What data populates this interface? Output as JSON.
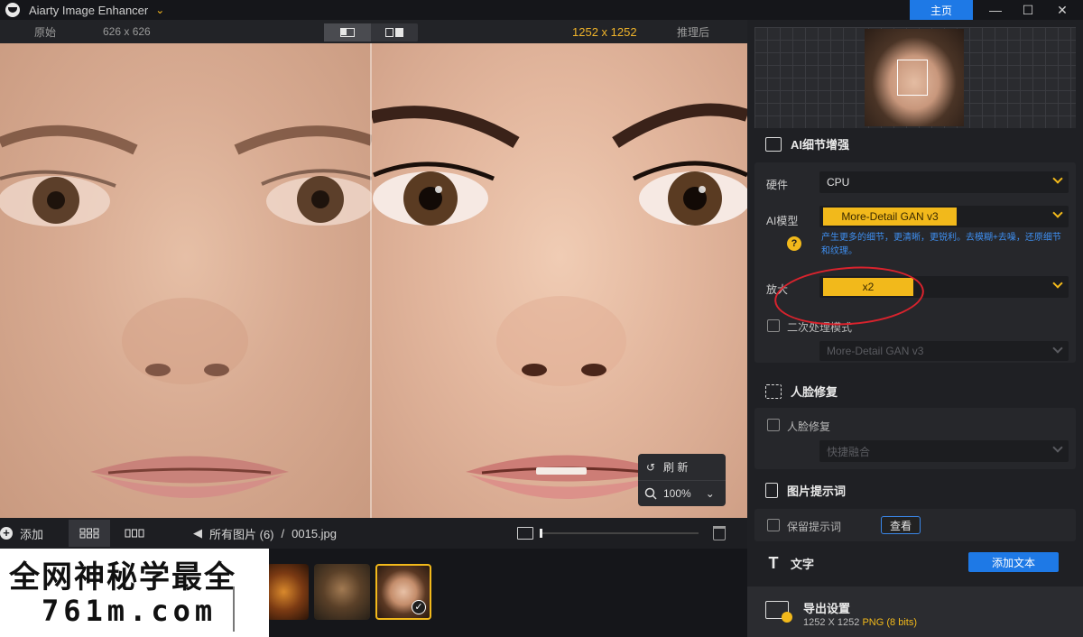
{
  "app": {
    "title": "Aiarty Image Enhancer",
    "home_label": "主页",
    "window_controls": [
      "—",
      "☐",
      "✕"
    ]
  },
  "compare": {
    "original_label": "原始",
    "original_resolution": "626 x 626",
    "enhanced_resolution": "1252 x 1252",
    "enhanced_label": "推理后"
  },
  "overlay": {
    "refresh_label": "刷 新",
    "zoom_value": "100%"
  },
  "bottom": {
    "add_label": "添加",
    "breadcrumb_all": "所有图片 (6)",
    "breadcrumb_sep": "/",
    "breadcrumb_file": "0015.jpg"
  },
  "watermark": {
    "line1": "全网神秘学最全",
    "line2": "761m.com"
  },
  "panel": {
    "detail_title": "AI细节增强",
    "hardware_label": "硬件",
    "hardware_value": "CPU",
    "model_label": "AI模型",
    "model_value": "More-Detail GAN  v3",
    "model_desc": "产生更多的细节，更清晰，更锐利。去模糊+去噪，还原细节和纹理。",
    "scale_label": "放大",
    "scale_value": "x2",
    "secondary_label": "二次处理模式",
    "secondary_value": "More-Detail GAN  v3",
    "face_title": "人脸修复",
    "face_checkbox": "人脸修复",
    "face_select": "快捷融合",
    "prompt_title": "图片提示词",
    "prompt_checkbox": "保留提示词",
    "prompt_view": "查看",
    "text_title": "文字",
    "add_text": "添加文本",
    "export_title": "导出设置",
    "export_res": "1252 X 1252",
    "export_format": "PNG",
    "export_bits": "(8 bits)"
  },
  "colors": {
    "accent": "#f2b91b",
    "primary_blue": "#1e79e6",
    "highlight_ring": "#d9232d"
  }
}
